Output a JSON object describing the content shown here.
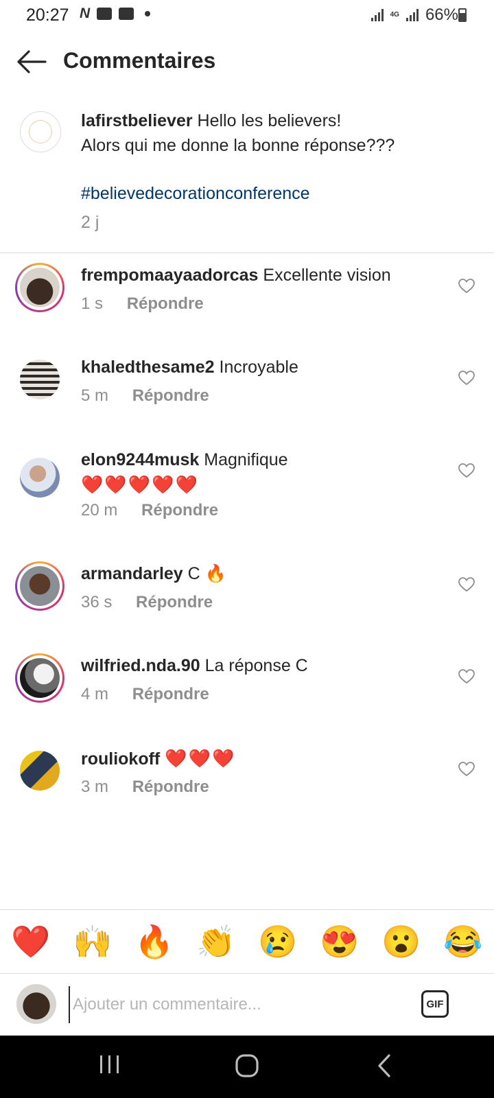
{
  "status": {
    "time": "20:27",
    "network": "4G",
    "battery": "66%"
  },
  "header": {
    "title": "Commentaires"
  },
  "caption": {
    "username": "lafirstbeliever",
    "line1": "Hello les believers!",
    "line2": "Alors qui me donne la bonne réponse???",
    "hashtag": "#believedecorationconference",
    "time": "2 j"
  },
  "comments": [
    {
      "username": "frempomaayaadorcas",
      "text": "Excellente vision",
      "time": "1 s",
      "reply": "Répondre"
    },
    {
      "username": "khaledthesame2",
      "text": "Incroyable",
      "time": "5 m",
      "reply": "Répondre"
    },
    {
      "username": "elon9244musk",
      "text": "Magnifique",
      "emoji": "❤️❤️❤️❤️❤️",
      "time": "20 m",
      "reply": "Répondre"
    },
    {
      "username": "armandarley",
      "text": "C 🔥",
      "time": "36 s",
      "reply": "Répondre"
    },
    {
      "username": "wilfried.nda.90",
      "text": "La réponse C",
      "time": "4 m",
      "reply": "Répondre"
    },
    {
      "username": "rouliokoff",
      "text": "❤️❤️❤️",
      "time": "3 m",
      "reply": "Répondre"
    }
  ],
  "emoji_bar": [
    "❤️",
    "🙌",
    "🔥",
    "👏",
    "😢",
    "😍",
    "😮",
    "😂"
  ],
  "composer": {
    "placeholder": "Ajouter un commentaire...",
    "gif_label": "GIF"
  }
}
